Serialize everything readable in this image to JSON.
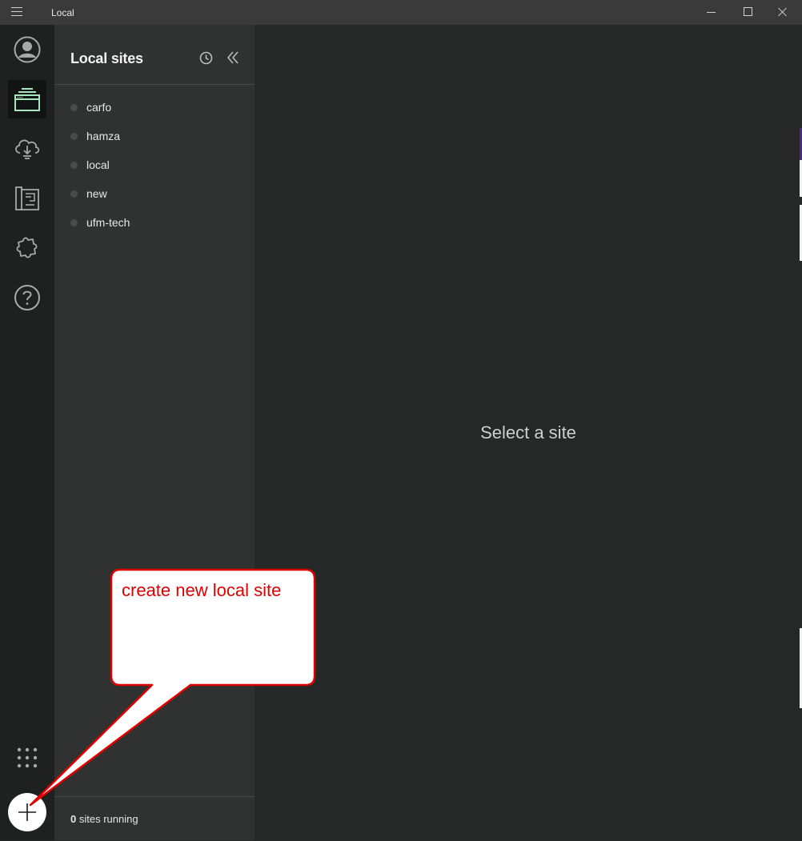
{
  "window": {
    "title": "Local"
  },
  "rail": {
    "items": [
      {
        "icon": "user-avatar-icon"
      },
      {
        "icon": "local-sites-icon",
        "active": true
      },
      {
        "icon": "cloud-connect-icon"
      },
      {
        "icon": "blueprints-icon"
      },
      {
        "icon": "addons-puzzle-icon"
      },
      {
        "icon": "help-icon"
      }
    ],
    "apps_icon": "apps-grid-icon",
    "add_icon": "plus-icon"
  },
  "sidebar": {
    "title": "Local sites",
    "sites": [
      {
        "name": "carfo"
      },
      {
        "name": "hamza"
      },
      {
        "name": "local"
      },
      {
        "name": "new"
      },
      {
        "name": "ufm-tech"
      }
    ],
    "footer": {
      "running_count": "0",
      "running_label": "sites running"
    }
  },
  "main": {
    "empty_message": "Select a site"
  },
  "annotation": {
    "text": "create new local site",
    "color": "#e00000"
  },
  "colors": {
    "rail_bg": "#1f2020",
    "sidebar_bg": "#303131",
    "main_bg": "#262727",
    "accent_green": "#a8e6bf"
  }
}
